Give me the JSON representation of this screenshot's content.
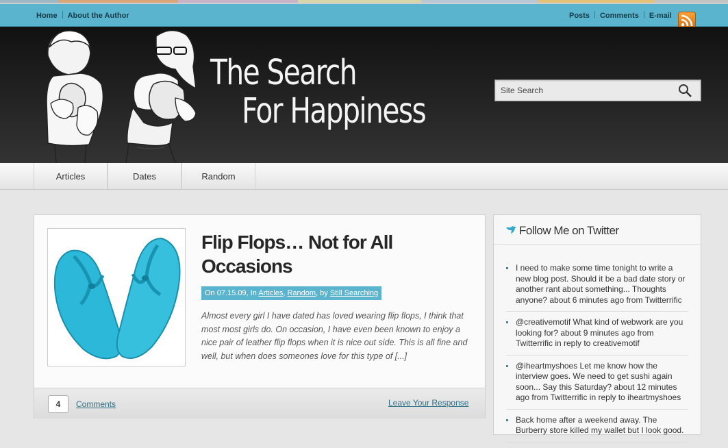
{
  "top_nav": {
    "left": [
      "Home",
      "About the Author"
    ],
    "right": [
      "Posts",
      "Comments",
      "E-mail"
    ]
  },
  "site": {
    "title_line1": "The Search",
    "title_line2": "For Happiness"
  },
  "search": {
    "placeholder": "Site Search"
  },
  "main_nav": [
    "Articles",
    "Dates",
    "Random"
  ],
  "post": {
    "title": "Flip Flops… Not for All Occasions",
    "meta_prefix": "On 07.15.09, In ",
    "meta_categories": [
      "Articles",
      "Random"
    ],
    "meta_by": ", by ",
    "meta_author": "Still Searching",
    "excerpt": "Almost every girl I have dated has loved wearing flip flops, I think that most most girls do.  On occasion, I have even been known to enjoy a nice pair of leather flip flops when it is nice out side.  This is all fine and well, but when does someones love for this type of [...]",
    "comment_count": "4",
    "comments_label": "Comments",
    "leave_response_label": "Leave Your Response"
  },
  "sidebar": {
    "widget_title": "Follow Me on Twitter",
    "tweets": [
      "I need to make some time tonight to write a new blog post. Should it be a bad date story or another rant about something... Thoughts anyone? about 6 minutes ago from Twitterrific",
      "@creativemotif What kind of webwork are you looking for? about 9 minutes ago from Twitterrific in reply to creativemotif",
      "@iheartmyshoes Let me know how the interview goes. We need to get sushi again soon... Say this Saturday? about 12 minutes ago from Twitterrific in reply to iheartmyshoes",
      "Back home after a weekend away. The Burberry store killed my wallet but I look good."
    ]
  },
  "colors": {
    "accent": "#5bb4cd",
    "header_bg": "#1b1b1b",
    "link": "#2d6f83",
    "flipflop": "#2cb8d8"
  },
  "icons": [
    "rss-icon",
    "search-icon",
    "twitter-bird-icon"
  ]
}
